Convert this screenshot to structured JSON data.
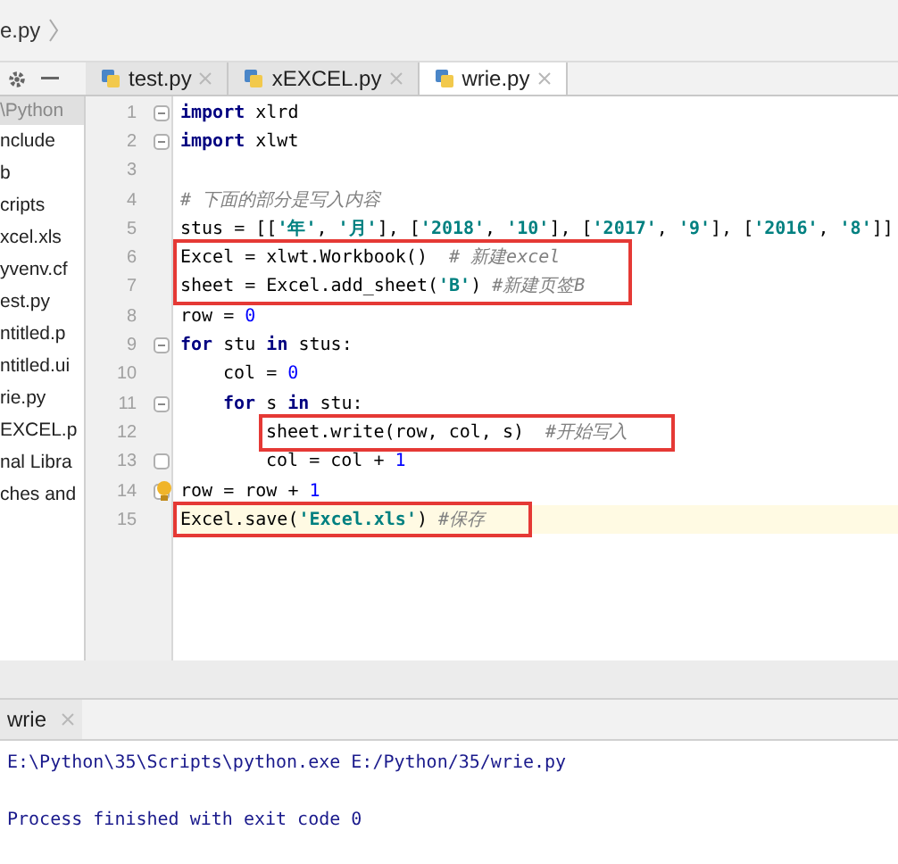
{
  "breadcrumb": "e.py",
  "tabs": [
    {
      "label": "test.py",
      "selected": false
    },
    {
      "label": "xEXCEL.py",
      "selected": false
    },
    {
      "label": "wrie.py",
      "selected": true
    }
  ],
  "sidebar": {
    "header": "\\Python",
    "items": [
      "nclude",
      "b",
      "cripts",
      "xcel.xls",
      "yvenv.cf",
      "est.py",
      "ntitled.p",
      "ntitled.ui",
      "rie.py",
      "EXCEL.p",
      "nal Libra",
      "ches and"
    ]
  },
  "code_lines": [
    {
      "number": "1",
      "fold_start": true,
      "tokens": [
        {
          "kind": "keyword",
          "text": "import"
        },
        {
          "kind": "plain",
          "text": " xlrd"
        }
      ]
    },
    {
      "number": "2",
      "fold_start": true,
      "tokens": [
        {
          "kind": "keyword",
          "text": "import"
        },
        {
          "kind": "plain",
          "text": " xlwt"
        }
      ]
    },
    {
      "number": "3"
    },
    {
      "number": "4",
      "tokens": [
        {
          "kind": "comment",
          "text": "# 下面的部分是写入内容"
        }
      ]
    },
    {
      "number": "5",
      "tokens": [
        {
          "kind": "plain",
          "text": "stus = [["
        },
        {
          "kind": "string",
          "text": "'年'"
        },
        {
          "kind": "plain",
          "text": ", "
        },
        {
          "kind": "string",
          "text": "'月'"
        },
        {
          "kind": "plain",
          "text": "], ["
        },
        {
          "kind": "string",
          "text": "'2018'"
        },
        {
          "kind": "plain",
          "text": ", "
        },
        {
          "kind": "string",
          "text": "'10'"
        },
        {
          "kind": "plain",
          "text": "], ["
        },
        {
          "kind": "string",
          "text": "'2017'"
        },
        {
          "kind": "plain",
          "text": ", "
        },
        {
          "kind": "string",
          "text": "'9'"
        },
        {
          "kind": "plain",
          "text": "], ["
        },
        {
          "kind": "string",
          "text": "'2016'"
        },
        {
          "kind": "plain",
          "text": ", "
        },
        {
          "kind": "string",
          "text": "'8'"
        },
        {
          "kind": "plain",
          "text": "]]"
        }
      ]
    },
    {
      "number": "6",
      "boxed": true,
      "tokens": [
        {
          "kind": "plain",
          "text": "Excel = xlwt.Workbook()  "
        },
        {
          "kind": "comment",
          "text": "# 新建excel"
        }
      ]
    },
    {
      "number": "7",
      "boxed": true,
      "tokens": [
        {
          "kind": "plain",
          "text": "sheet = Excel.add_sheet("
        },
        {
          "kind": "string",
          "text": "'B'"
        },
        {
          "kind": "plain",
          "text": ") "
        },
        {
          "kind": "comment",
          "text": "#新建页签B"
        }
      ]
    },
    {
      "number": "8",
      "tokens": [
        {
          "kind": "plain",
          "text": "row = "
        },
        {
          "kind": "number",
          "text": "0"
        }
      ]
    },
    {
      "number": "9",
      "fold_start": true,
      "tokens": [
        {
          "kind": "keyword",
          "text": "for"
        },
        {
          "kind": "plain",
          "text": " stu "
        },
        {
          "kind": "keyword",
          "text": "in"
        },
        {
          "kind": "plain",
          "text": " stus:"
        }
      ],
      "children": [
        {
          "number": "10",
          "tokens": [
            {
              "kind": "plain",
              "text": "col = "
            },
            {
              "kind": "number",
              "text": "0"
            }
          ]
        },
        {
          "number": "11",
          "fold_start": true,
          "tokens": [
            {
              "kind": "keyword",
              "text": "for"
            },
            {
              "kind": "plain",
              "text": " s "
            },
            {
              "kind": "keyword",
              "text": "in"
            },
            {
              "kind": "plain",
              "text": " stu:"
            }
          ],
          "children": [
            {
              "number": "12",
              "boxed": true,
              "tokens": [
                {
                  "kind": "plain",
                  "text": "sheet.write(row, col, s)  "
                },
                {
                  "kind": "comment",
                  "text": "#开始写入"
                }
              ]
            },
            {
              "number": "13",
              "fold_end": true,
              "tokens": [
                {
                  "kind": "plain",
                  "text": "col = col + "
                },
                {
                  "kind": "number",
                  "text": "1"
                }
              ]
            }
          ]
        }
      ]
    },
    {
      "number": "14",
      "fold_end": true,
      "hint": true,
      "tokens": [
        {
          "kind": "plain",
          "text": "row = row + "
        },
        {
          "kind": "number",
          "text": "1"
        }
      ]
    },
    {
      "number": "15",
      "current": true,
      "boxed": true,
      "tokens": [
        {
          "kind": "plain",
          "text": "Excel.save("
        },
        {
          "kind": "string",
          "text": "'Excel.xls'"
        },
        {
          "kind": "plain",
          "text": ") "
        },
        {
          "kind": "comment",
          "text": "#保存"
        }
      ]
    }
  ],
  "run_tab": {
    "label": "wrie"
  },
  "console": [
    "E:\\Python\\35\\Scripts\\python.exe E:/Python/35/wrie.py",
    "Process finished with exit code 0"
  ]
}
